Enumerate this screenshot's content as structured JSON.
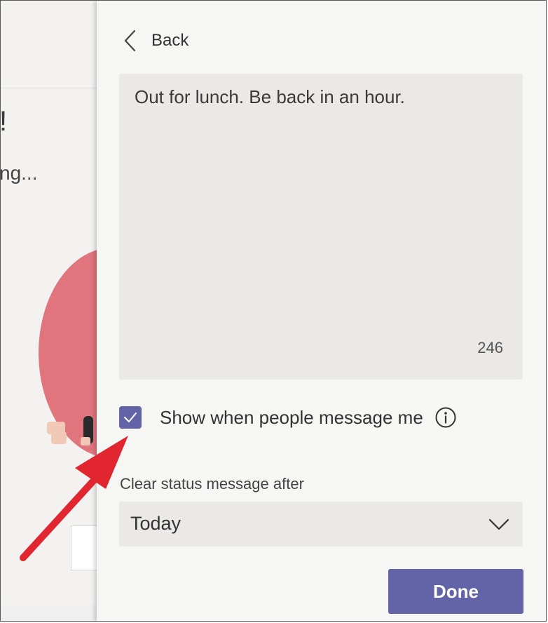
{
  "background_app": {
    "heading_fragment": "!",
    "subtext_fragment": "ng..."
  },
  "panel": {
    "back_label": "Back",
    "message": {
      "value": "Out for lunch. Be back in an hour.",
      "remaining_chars": "246"
    },
    "show_when_messaged": {
      "label": "Show when people message me",
      "checked": true
    },
    "clear_after": {
      "label": "Clear status message after",
      "selected": "Today"
    },
    "done_label": "Done"
  },
  "colors": {
    "accent": "#6264a7",
    "annotation_arrow": "#e2262f",
    "field_bg": "#ebe9e8"
  },
  "icons": [
    "chevron-left-icon",
    "checkmark-icon",
    "info-icon",
    "chevron-down-icon",
    "annotation-arrow"
  ]
}
